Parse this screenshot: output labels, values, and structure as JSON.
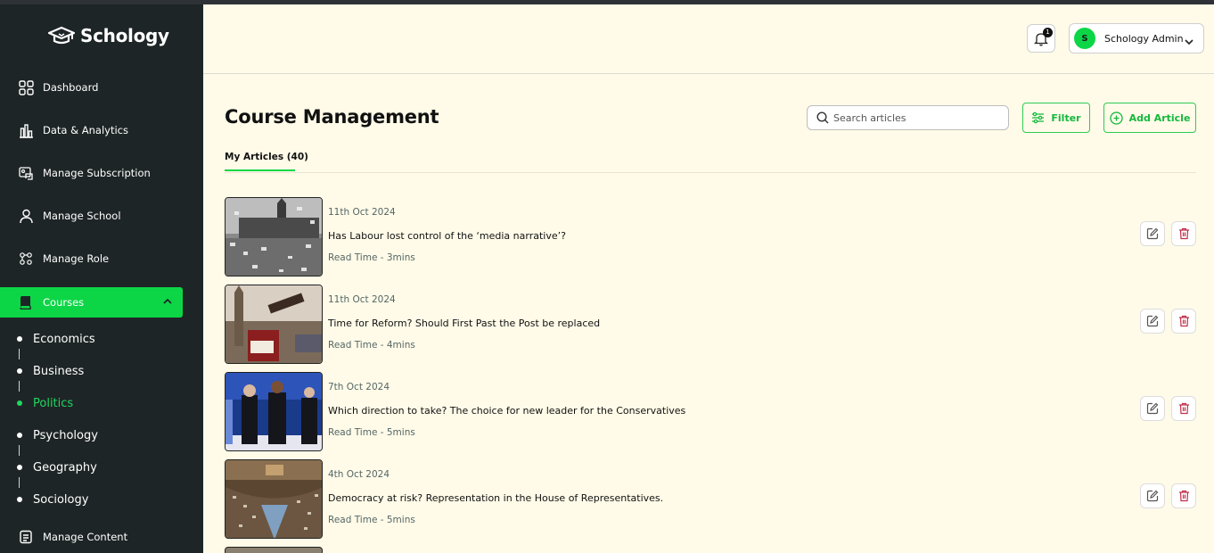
{
  "brand": {
    "name": "Schology"
  },
  "sidebar": {
    "items": [
      {
        "label": "Dashboard",
        "icon": "grid-icon"
      },
      {
        "label": "Data & Analytics",
        "icon": "bar-chart-icon"
      },
      {
        "label": "Manage Subscription",
        "icon": "subscription-icon"
      },
      {
        "label": "Manage School",
        "icon": "user-icon"
      },
      {
        "label": "Manage Role",
        "icon": "roles-icon"
      },
      {
        "label": "Courses",
        "icon": "book-icon",
        "active": true
      },
      {
        "label": "Manage Content",
        "icon": "document-icon"
      }
    ],
    "courses": [
      "Economics",
      "Business",
      "Politics",
      "Psychology",
      "Geography",
      "Sociology"
    ],
    "selected_course": "Politics"
  },
  "header": {
    "notification_count": "1",
    "user": {
      "initial": "S",
      "name": "Schology Admin"
    }
  },
  "main": {
    "title": "Course Management",
    "search_placeholder": "Search articles",
    "filter_label": "Filter",
    "add_label": "Add Article",
    "tab_label": "My Articles (40)",
    "articles": [
      {
        "date": "11th Oct 2024",
        "title": "Has Labour lost control of the ‘media narrative’?",
        "read_time": "Read Time - 3mins"
      },
      {
        "date": "11th Oct 2024",
        "title": "Time for Reform? Should First Past the Post be replaced",
        "read_time": "Read Time - 4mins"
      },
      {
        "date": "7th Oct 2024",
        "title": "Which direction to take? The choice for new leader for the Conservatives",
        "read_time": "Read Time - 5mins"
      },
      {
        "date": "4th Oct 2024",
        "title": "Democracy at risk? Representation in the House of Representatives.",
        "read_time": "Read Time - 5mins"
      }
    ]
  },
  "colors": {
    "accent": "#0dd646",
    "sidebar_bg": "#1e2526",
    "page_bg": "#fffbe8",
    "delete": "#c0304a"
  }
}
